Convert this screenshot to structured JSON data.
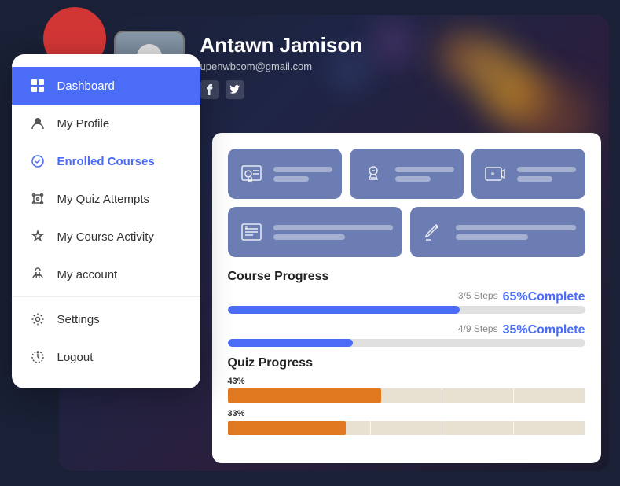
{
  "user": {
    "name": "Antawn Jamison",
    "email": "upenwbcom@gmail.com"
  },
  "social": {
    "facebook": "f",
    "twitter": "t"
  },
  "sidebar": {
    "items": [
      {
        "id": "dashboard",
        "label": "Dashboard",
        "active": true
      },
      {
        "id": "my-profile",
        "label": "My Profile",
        "active": false
      },
      {
        "id": "enrolled-courses",
        "label": "Enrolled Courses",
        "active": false
      },
      {
        "id": "my-quiz-attempts",
        "label": "My Quiz Attempts",
        "active": false
      },
      {
        "id": "my-course-activity",
        "label": "My Course Activity",
        "active": false
      },
      {
        "id": "my-account",
        "label": "My account",
        "active": false
      },
      {
        "id": "settings",
        "label": "Settings",
        "active": false
      },
      {
        "id": "logout",
        "label": "Logout",
        "active": false
      }
    ]
  },
  "stats": {
    "cards": [
      {
        "id": "card-1",
        "icon": "certificate"
      },
      {
        "id": "card-2",
        "icon": "book"
      },
      {
        "id": "card-3",
        "icon": "video"
      },
      {
        "id": "card-4",
        "icon": "list"
      },
      {
        "id": "card-5",
        "icon": "edit"
      }
    ]
  },
  "courseProgress": {
    "title": "Course Progress",
    "items": [
      {
        "steps": "3/5 Steps",
        "complete": "65%Complete",
        "percent": 65,
        "color": "#4a6cf7"
      },
      {
        "steps": "4/9 Steps",
        "complete": "35%Complete",
        "percent": 35,
        "color": "#4a6cf7"
      }
    ]
  },
  "quizProgress": {
    "title": "Quiz Progress",
    "items": [
      {
        "label": "43%",
        "percent": 43
      },
      {
        "label": "33%",
        "percent": 33
      }
    ]
  }
}
